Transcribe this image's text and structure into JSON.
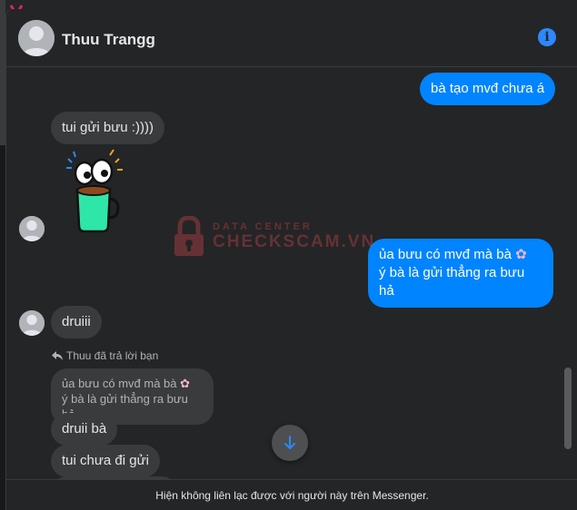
{
  "header": {
    "contact_name": "Thuu Trangg",
    "info_icon": "info-icon"
  },
  "messages": {
    "out_1": "bà tạo mvđ chưa á",
    "in_1": "tui gửi bưu :))))",
    "out_2_line1": "ủa bưu có mvđ mà bà",
    "out_2_line2": "ý bà là gửi thẳng ra bưu hả",
    "in_2": "druiii",
    "reply_label": "Thuu đã trả lời bạn",
    "quoted_line1": "ủa bưu có mvđ mà bà",
    "quoted_line2": "ý bà là gửi thẳng ra bưu hả",
    "in_3": "druii bà",
    "in_4": "tui chưa đi gửi"
  },
  "watermark": {
    "top": "DATA CENTER",
    "main": "CHECKSCAM.VN"
  },
  "footer": {
    "notice": "Hiện không liên lạc được với người này trên Messenger."
  },
  "colors": {
    "outgoing_bubble": "#0084ff",
    "incoming_bubble": "#3a3b3c",
    "background": "#242526",
    "accent": "#2d88ff"
  }
}
